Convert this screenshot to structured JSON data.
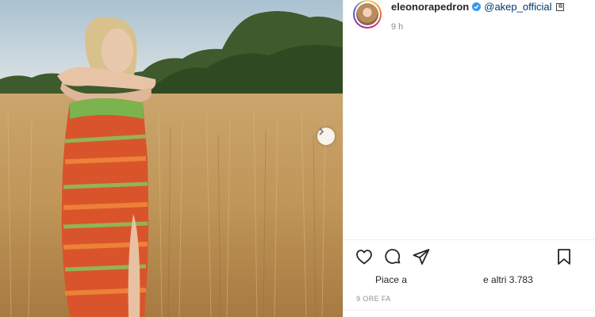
{
  "post": {
    "username": "eleonorapedron",
    "mention": "@akep_official",
    "emoji": "⧉",
    "time_ago": "9 h",
    "likes_prefix": "Piace a",
    "likes_suffix": "e altri 3.783",
    "timestamp": "9 ORE FA"
  },
  "icons": {
    "like": "heart-icon",
    "comment": "comment-icon",
    "share": "paper-plane-icon",
    "save": "bookmark-icon",
    "next": "chevron-right-icon",
    "verified": "verified-badge-icon"
  },
  "colors": {
    "accent_link": "#00376b",
    "verified_blue": "#3897f0",
    "muted_text": "#8e8e8e"
  }
}
